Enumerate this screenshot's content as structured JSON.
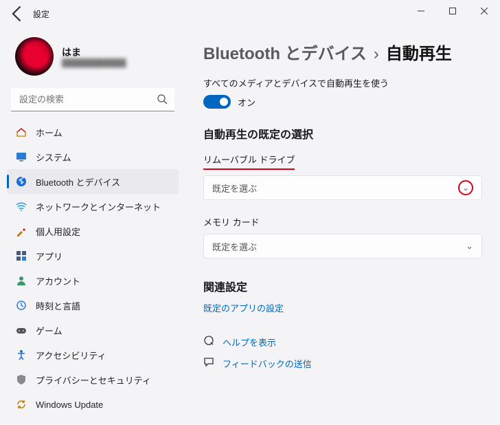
{
  "window": {
    "title": "設定"
  },
  "user": {
    "name": "はま",
    "sub": "████████████"
  },
  "search": {
    "placeholder": "設定の検索"
  },
  "sidebar": {
    "items": [
      {
        "label": "ホーム"
      },
      {
        "label": "システム"
      },
      {
        "label": "Bluetooth とデバイス",
        "selected": true
      },
      {
        "label": "ネットワークとインターネット"
      },
      {
        "label": "個人用設定"
      },
      {
        "label": "アプリ"
      },
      {
        "label": "アカウント"
      },
      {
        "label": "時刻と言語"
      },
      {
        "label": "ゲーム"
      },
      {
        "label": "アクセシビリティ"
      },
      {
        "label": "プライバシーとセキュリティ"
      },
      {
        "label": "Windows Update"
      }
    ]
  },
  "breadcrumb": {
    "parent": "Bluetooth とデバイス",
    "sep": "›",
    "leaf": "自動再生"
  },
  "main": {
    "toggle_desc": "すべてのメディアとデバイスで自動再生を使う",
    "toggle_label": "オン",
    "defaults_heading": "自動再生の既定の選択",
    "fields": [
      {
        "label": "リムーバブル ドライブ",
        "value": "既定を選ぶ",
        "highlighted": true
      },
      {
        "label": "メモリ カード",
        "value": "既定を選ぶ",
        "highlighted": false
      }
    ],
    "related_heading": "関連設定",
    "related_link": "既定のアプリの設定",
    "help_link": "ヘルプを表示",
    "feedback_link": "フィードバックの送信"
  }
}
